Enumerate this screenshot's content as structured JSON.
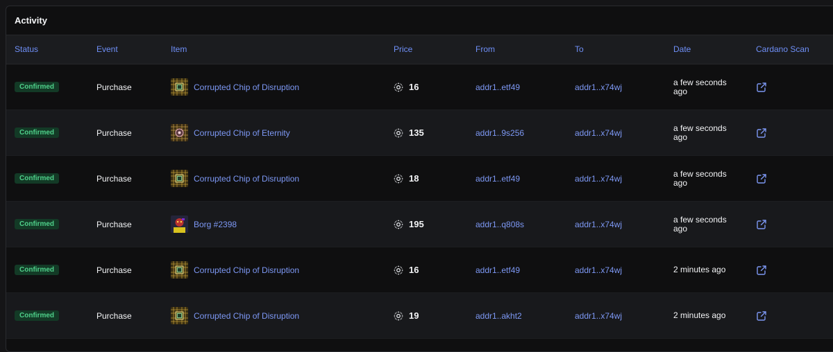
{
  "panel": {
    "title": "Activity"
  },
  "columns": {
    "status": "Status",
    "event": "Event",
    "item": "Item",
    "price": "Price",
    "from": "From",
    "to": "To",
    "date": "Date",
    "scan": "Cardano Scan"
  },
  "rows": [
    {
      "status": "Confirmed",
      "event": "Purchase",
      "item": "Corrupted Chip of Disruption",
      "thumb": "chip-disruption",
      "price": "16",
      "from": "addr1..etf49",
      "to": "addr1..x74wj",
      "date": "a few seconds ago"
    },
    {
      "status": "Confirmed",
      "event": "Purchase",
      "item": "Corrupted Chip of Eternity",
      "thumb": "chip-eternity",
      "price": "135",
      "from": "addr1..9s256",
      "to": "addr1..x74wj",
      "date": "a few seconds ago"
    },
    {
      "status": "Confirmed",
      "event": "Purchase",
      "item": "Corrupted Chip of Disruption",
      "thumb": "chip-disruption",
      "price": "18",
      "from": "addr1..etf49",
      "to": "addr1..x74wj",
      "date": "a few seconds ago"
    },
    {
      "status": "Confirmed",
      "event": "Purchase",
      "item": "Borg #2398",
      "thumb": "borg",
      "price": "195",
      "from": "addr1..q808s",
      "to": "addr1..x74wj",
      "date": "a few seconds ago"
    },
    {
      "status": "Confirmed",
      "event": "Purchase",
      "item": "Corrupted Chip of Disruption",
      "thumb": "chip-disruption",
      "price": "16",
      "from": "addr1..etf49",
      "to": "addr1..x74wj",
      "date": "2 minutes ago"
    },
    {
      "status": "Confirmed",
      "event": "Purchase",
      "item": "Corrupted Chip of Disruption",
      "thumb": "chip-disruption",
      "price": "19",
      "from": "addr1..akht2",
      "to": "addr1..x74wj",
      "date": "2 minutes ago"
    }
  ],
  "icons": {
    "currency": "ada-icon",
    "scan": "external-link-icon"
  },
  "colors": {
    "header_text": "#6f8ff7",
    "link": "#7d98f4",
    "badge_bg": "#133a26",
    "badge_text": "#4fd08a"
  }
}
